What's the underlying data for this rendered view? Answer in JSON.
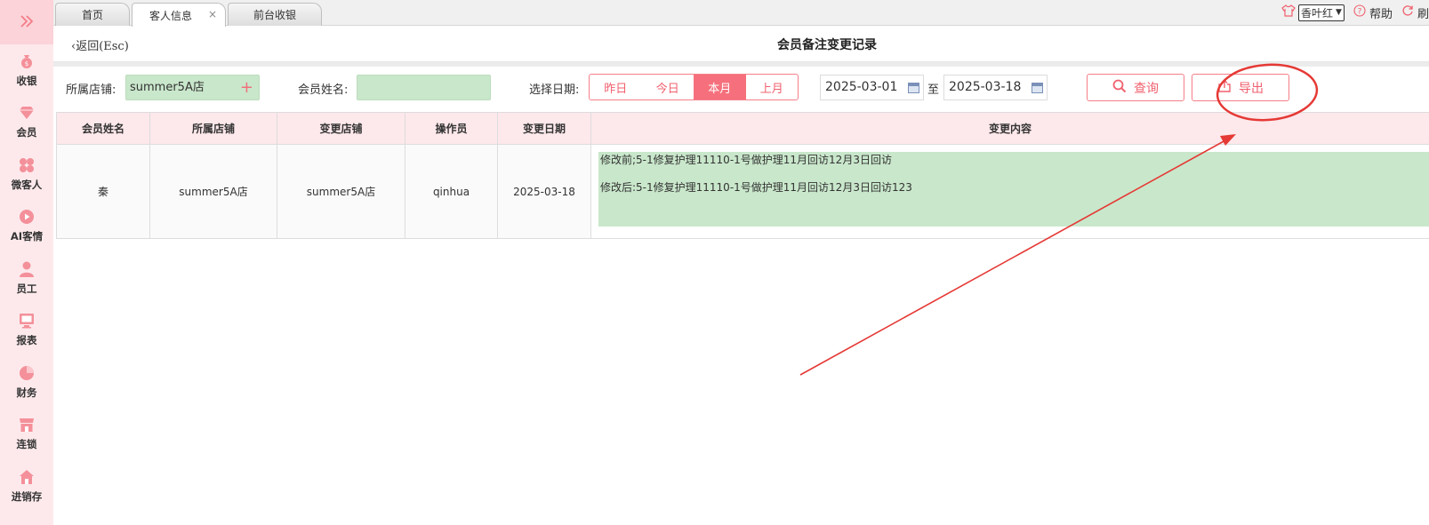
{
  "sidebar": {
    "toggle_icon": "double-chevron-right-icon",
    "accent": "#f47c88",
    "items": [
      {
        "label": "收银",
        "icon": "money-bag-icon"
      },
      {
        "label": "会员",
        "icon": "diamond-icon"
      },
      {
        "label": "微客人",
        "icon": "clover-icon"
      },
      {
        "label": "AI客情",
        "icon": "play-circle-icon"
      },
      {
        "label": "员工",
        "icon": "person-icon"
      },
      {
        "label": "报表",
        "icon": "monitor-icon"
      },
      {
        "label": "财务",
        "icon": "pie-chart-icon"
      },
      {
        "label": "连锁",
        "icon": "store-icon"
      },
      {
        "label": "进销存",
        "icon": "house-icon"
      }
    ]
  },
  "tabs": [
    {
      "label": "首页",
      "active": false
    },
    {
      "label": "客人信息",
      "active": true,
      "close": "×"
    },
    {
      "label": "前台收银",
      "active": false
    }
  ],
  "topbar": {
    "shop_select": "香叶红",
    "help": "帮助",
    "refresh": "刷"
  },
  "header": {
    "back": "返回(Esc)",
    "title": "会员备注变更记录"
  },
  "filters": {
    "store_label": "所属店铺:",
    "store_value": "summer5A店",
    "member_label": "会员姓名:",
    "member_value": "",
    "date_label": "选择日期:",
    "segments": [
      {
        "label": "昨日",
        "active": false
      },
      {
        "label": "今日",
        "active": false
      },
      {
        "label": "本月",
        "active": true
      },
      {
        "label": "上月",
        "active": false
      }
    ],
    "date_from": "2025-03-01",
    "to_label": "至",
    "date_to": "2025-03-18",
    "query_label": "查询",
    "export_label": "导出"
  },
  "table": {
    "columns": [
      "会员姓名",
      "所属店铺",
      "变更店铺",
      "操作员",
      "变更日期",
      "变更内容"
    ],
    "rows": [
      {
        "member": "秦",
        "store": "summer5A店",
        "change_store": "summer5A店",
        "operator": "qinhua",
        "date": "2025-03-18",
        "before": "修改前;5-1修复护理11110-1号做护理11月回访12月3日回访",
        "after": "修改后:5-1修复护理11110-1号做护理11月回访12月3日回访123"
      }
    ]
  },
  "annotation_color": "#e53935"
}
